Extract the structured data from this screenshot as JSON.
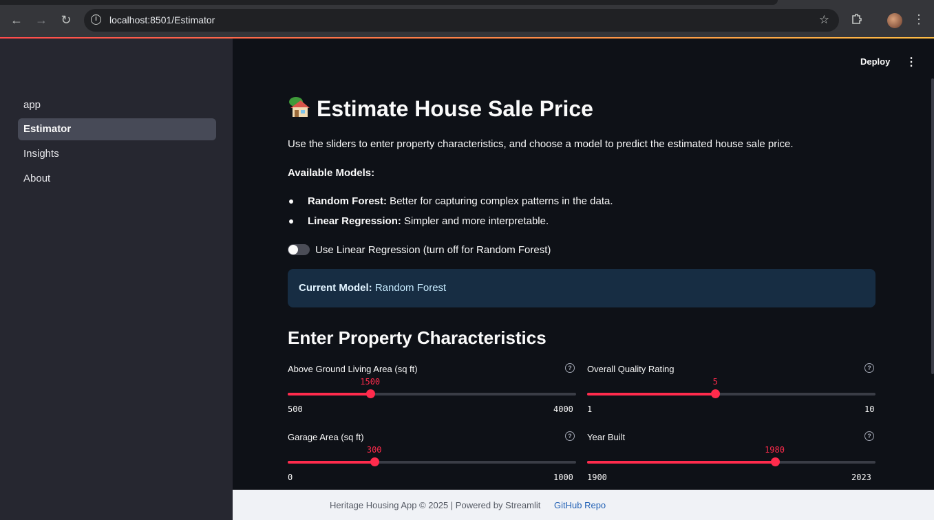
{
  "browser": {
    "url": "localhost:8501/Estimator"
  },
  "sidebar": {
    "items": [
      {
        "label": "app",
        "active": false
      },
      {
        "label": "Estimator",
        "active": true
      },
      {
        "label": "Insights",
        "active": false
      },
      {
        "label": "About",
        "active": false
      }
    ]
  },
  "header": {
    "deploy_label": "Deploy"
  },
  "main": {
    "title": "Estimate House Sale Price",
    "intro": "Use the sliders to enter property characteristics, and choose a model to predict the estimated house sale price.",
    "models_heading": "Available Models:",
    "models": [
      {
        "name": "Random Forest:",
        "desc": " Better for capturing complex patterns in the data."
      },
      {
        "name": "Linear Regression:",
        "desc": " Simpler and more interpretable."
      }
    ],
    "toggle": {
      "label": "Use Linear Regression (turn off for Random Forest)",
      "on": false
    },
    "current_model": {
      "label": "Current Model:",
      "value": "Random Forest"
    },
    "section_title": "Enter Property Characteristics",
    "sliders": [
      {
        "label": "Above Ground Living Area (sq ft)",
        "value": "1500",
        "min": "500",
        "max": "4000",
        "fraction": 0.2857
      },
      {
        "label": "Overall Quality Rating",
        "value": "5",
        "min": "1",
        "max": "10",
        "fraction": 0.4444
      },
      {
        "label": "Garage Area (sq ft)",
        "value": "300",
        "min": "0",
        "max": "1000",
        "fraction": 0.3
      },
      {
        "label": "Year Built",
        "value": "1980",
        "min": "1900",
        "max": "2023",
        "fraction": 0.6504
      }
    ]
  },
  "footer": {
    "text": "Heritage Housing App © 2025 | Powered by Streamlit",
    "link": "GitHub Repo"
  },
  "colors": {
    "accent": "#ff2b4c",
    "info_bg": "#172d43",
    "sidebar_bg": "#262730",
    "main_bg": "#0e1117"
  }
}
